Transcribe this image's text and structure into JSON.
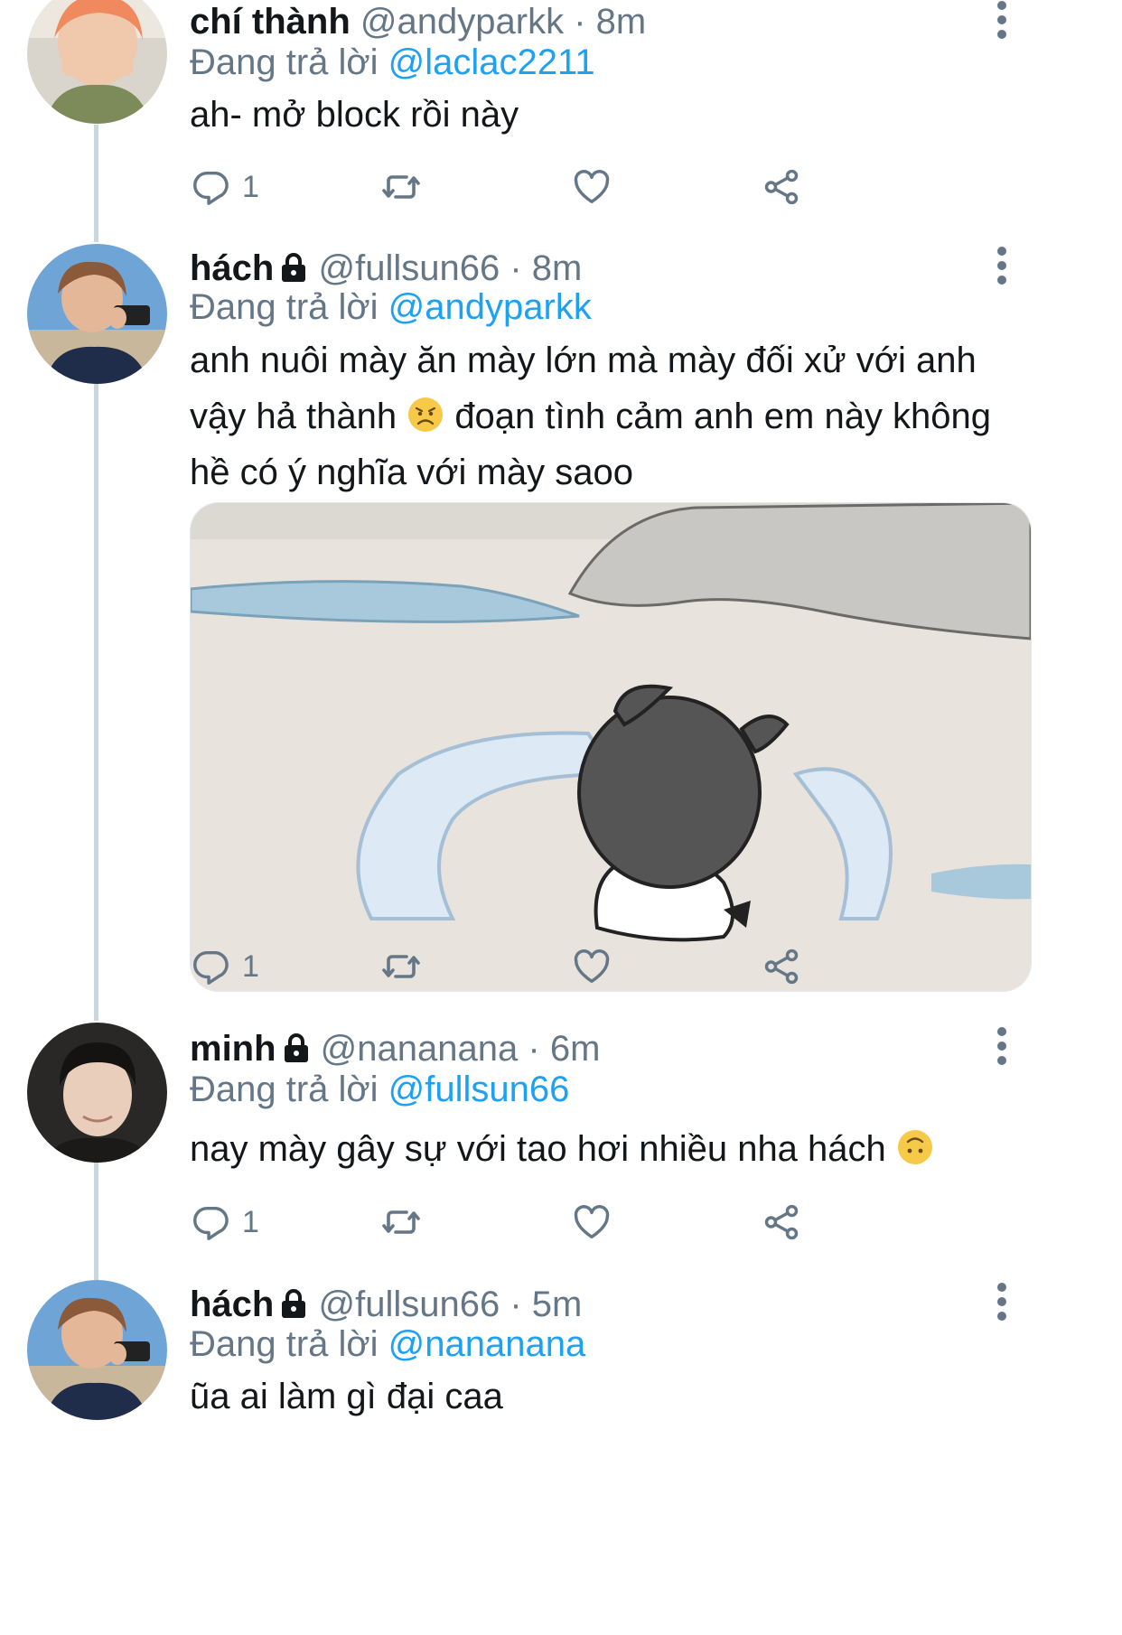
{
  "tweets": [
    {
      "name": "chí thành",
      "locked": false,
      "handle": "@andyparkk",
      "sep": "·",
      "time": "8m",
      "reply_prefix": "Đang trả lời",
      "reply_to": "@laclac2211",
      "text": "ah- mở block rồi này",
      "reply_count": "1"
    },
    {
      "name": "hách",
      "locked": true,
      "handle": "@fullsun66",
      "sep": "·",
      "time": "8m",
      "reply_prefix": "Đang trả lời",
      "reply_to": "@andyparkk",
      "text_lines": [
        "anh nuôi mày ăn mày lớn mà mày đối xử với anh",
        "vậy hả thành",
        "đoạn tình cảm anh em này không",
        "hề có ý nghĩa với mày saoo"
      ],
      "reply_count": "1"
    },
    {
      "name": "minh",
      "locked": true,
      "handle": "@nananana",
      "sep": "·",
      "time": "6m",
      "reply_prefix": "Đang trả lời",
      "reply_to": "@fullsun66",
      "text": "nay mày gây sự với tao hơi nhiều nha hách",
      "reply_count": "1"
    },
    {
      "name": "hách",
      "locked": true,
      "handle": "@fullsun66",
      "sep": "·",
      "time": "5m",
      "reply_prefix": "Đang trả lời",
      "reply_to": "@nananana",
      "text": "ũa ai làm gì đại caa"
    }
  ],
  "icons": {
    "reply": "reply-icon",
    "retweet": "retweet-icon",
    "like": "heart-icon",
    "share": "share-icon",
    "more": "more-options-icon",
    "lock": "lock-icon",
    "emoji_sad": "disappointed-face-emoji",
    "emoji_upside": "upside-down-face-emoji"
  },
  "colors": {
    "text": "#14171a",
    "muted": "#657786",
    "mention": "#1da1f2",
    "thread_line": "#ccd6dd"
  }
}
